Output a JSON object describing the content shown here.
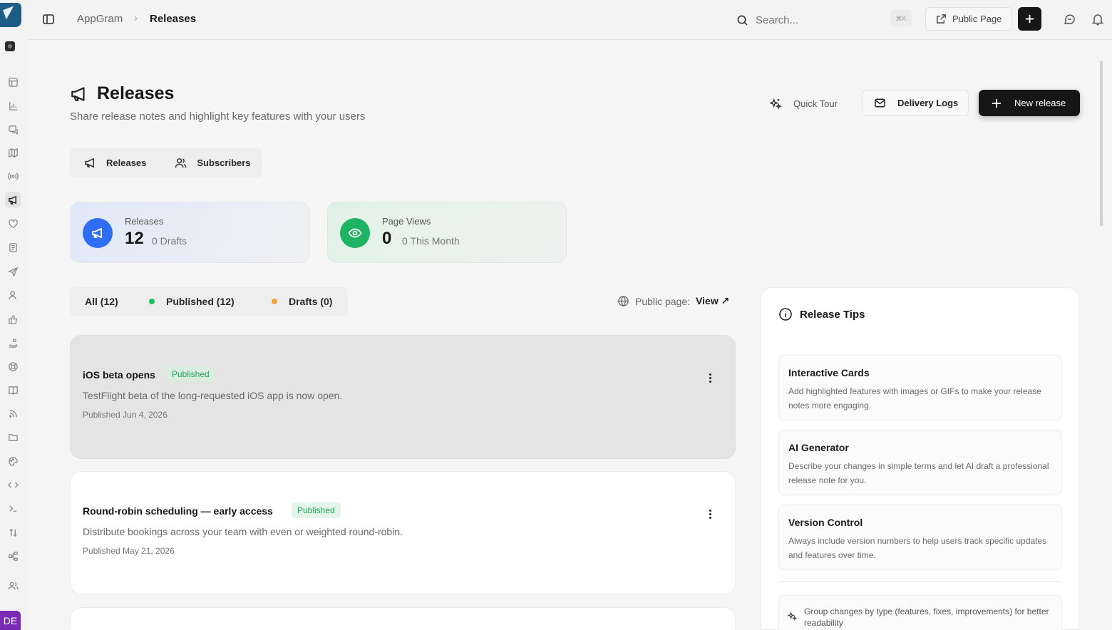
{
  "sidebar": {
    "avatar_initials": "DE",
    "items": [
      {
        "icon": "layout-icon"
      },
      {
        "icon": "bar-chart-icon"
      },
      {
        "icon": "chat-icon"
      },
      {
        "icon": "map-icon"
      },
      {
        "icon": "broadcast-icon"
      },
      {
        "icon": "megaphone-icon",
        "active": true
      },
      {
        "icon": "heart-icon"
      },
      {
        "icon": "notes-icon"
      },
      {
        "icon": "send-icon"
      },
      {
        "icon": "user-icon"
      },
      {
        "icon": "thumbs-up-icon"
      },
      {
        "icon": "hand-coins-icon"
      },
      {
        "icon": "lifebuoy-icon"
      },
      {
        "icon": "book-icon"
      },
      {
        "icon": "rss-icon"
      },
      {
        "icon": "folder-icon"
      },
      {
        "icon": "palette-icon"
      },
      {
        "icon": "code-icon"
      },
      {
        "icon": "terminal-icon"
      },
      {
        "icon": "sort-icon"
      },
      {
        "icon": "workflow-icon"
      },
      {
        "icon": "team-icon"
      }
    ]
  },
  "topbar": {
    "breadcrumb": [
      "AppGram",
      "Releases"
    ],
    "breadcrumb_sep": "›",
    "search_placeholder": "Search...",
    "shortcut": "⌘K",
    "public_page_label": "Public Page"
  },
  "header": {
    "title": "Releases",
    "subtitle": "Share release notes and highlight key features with your users",
    "quick_tour_label": "Quick Tour",
    "delivery_logs_label": "Delivery Logs",
    "new_release_label": "New release"
  },
  "tabs": [
    {
      "label": "Releases",
      "icon": "megaphone-icon"
    },
    {
      "label": "Subscribers",
      "icon": "users-icon"
    }
  ],
  "stats": [
    {
      "label": "Releases",
      "value": "12",
      "sub": "0 Drafts",
      "color": "#2f6ef2",
      "icon": "megaphone-icon"
    },
    {
      "label": "Page Views",
      "value": "0",
      "sub": "0 This Month",
      "color": "#1eb463",
      "icon": "eye-icon"
    }
  ],
  "filters": {
    "all": "All (12)",
    "published": "Published (12)",
    "drafts": "Drafts (0)",
    "public_page_prefix": "Public page:",
    "public_page_link": "View ↗"
  },
  "releases": [
    {
      "title": "iOS beta opens",
      "status": "Published",
      "description": "TestFlight beta of the long-requested iOS app is now open.",
      "date": "Published Jun 4, 2026"
    },
    {
      "title": "Round-robin scheduling — early access",
      "status": "Published",
      "description": "Distribute bookings across your team with even or weighted round-robin.",
      "date": "Published May 21, 2026"
    }
  ],
  "tips": {
    "title": "Release Tips",
    "items": [
      {
        "title": "Interactive Cards",
        "description": "Add highlighted features with images or GIFs to make your release notes more engaging."
      },
      {
        "title": "AI Generator",
        "description": "Describe your changes in simple terms and let AI draft a professional release note for you."
      },
      {
        "title": "Version Control",
        "description": "Always include version numbers to help users track specific updates and features over time."
      }
    ],
    "note": "Group changes by type (features, fixes, improvements) for better readability"
  }
}
